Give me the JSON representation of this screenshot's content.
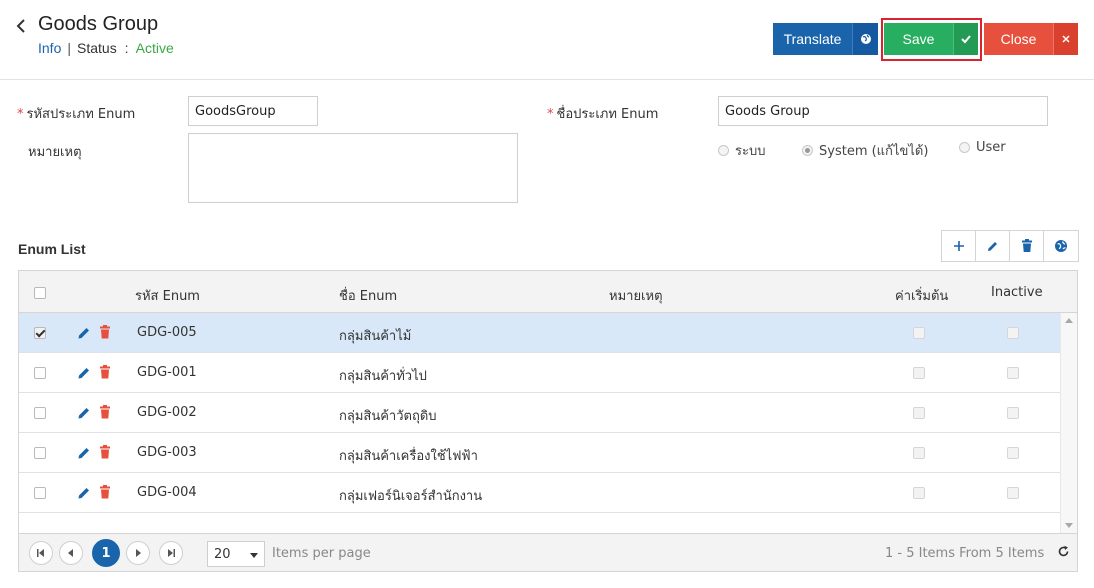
{
  "header": {
    "title": "Goods Group",
    "info_label": "Info",
    "separator": "|",
    "status_label": "Status",
    "colon": ":",
    "status_value": "Active",
    "translate_label": "Translate",
    "save_label": "Save",
    "close_label": "Close"
  },
  "form": {
    "code_label": "รหัสประเภท Enum",
    "code_value": "GoodsGroup",
    "name_label": "ชื่อประเภท Enum",
    "name_value": "Goods Group",
    "remark_label": "หมายเหตุ",
    "required_mark": "*",
    "radio_options": [
      {
        "label": "ระบบ",
        "selected": false
      },
      {
        "label": "System (แก้ไขได้)",
        "selected": true
      },
      {
        "label": "User",
        "selected": false
      }
    ]
  },
  "enum_list": {
    "title": "Enum List",
    "columns": {
      "code": "รหัส Enum",
      "name": "ชื่อ Enum",
      "remark": "หมายเหตุ",
      "default": "ค่าเริ่มต้น",
      "inactive": "Inactive"
    },
    "rows": [
      {
        "code": "GDG-005",
        "name": "กลุ่มสินค้าไม้",
        "checked": true
      },
      {
        "code": "GDG-001",
        "name": "กลุ่มสินค้าทั่วไป",
        "checked": false
      },
      {
        "code": "GDG-002",
        "name": "กลุ่มสินค้าวัตถุดิบ",
        "checked": false
      },
      {
        "code": "GDG-003",
        "name": "กลุ่มสินค้าเครื่องใช้ไฟฟ้า",
        "checked": false
      },
      {
        "code": "GDG-004",
        "name": "กลุ่มเฟอร์นิเจอร์สำนักงาน",
        "checked": false
      }
    ],
    "pager": {
      "current_page": "1",
      "page_size": "20",
      "items_per_page": "Items per page",
      "summary": "1 - 5 Items From 5 Items"
    }
  },
  "colors": {
    "primary": "#1a64ac",
    "success": "#27ae60",
    "danger": "#e8503e",
    "highlight": "#d9232d",
    "selected_row": "#d9e8f8"
  }
}
